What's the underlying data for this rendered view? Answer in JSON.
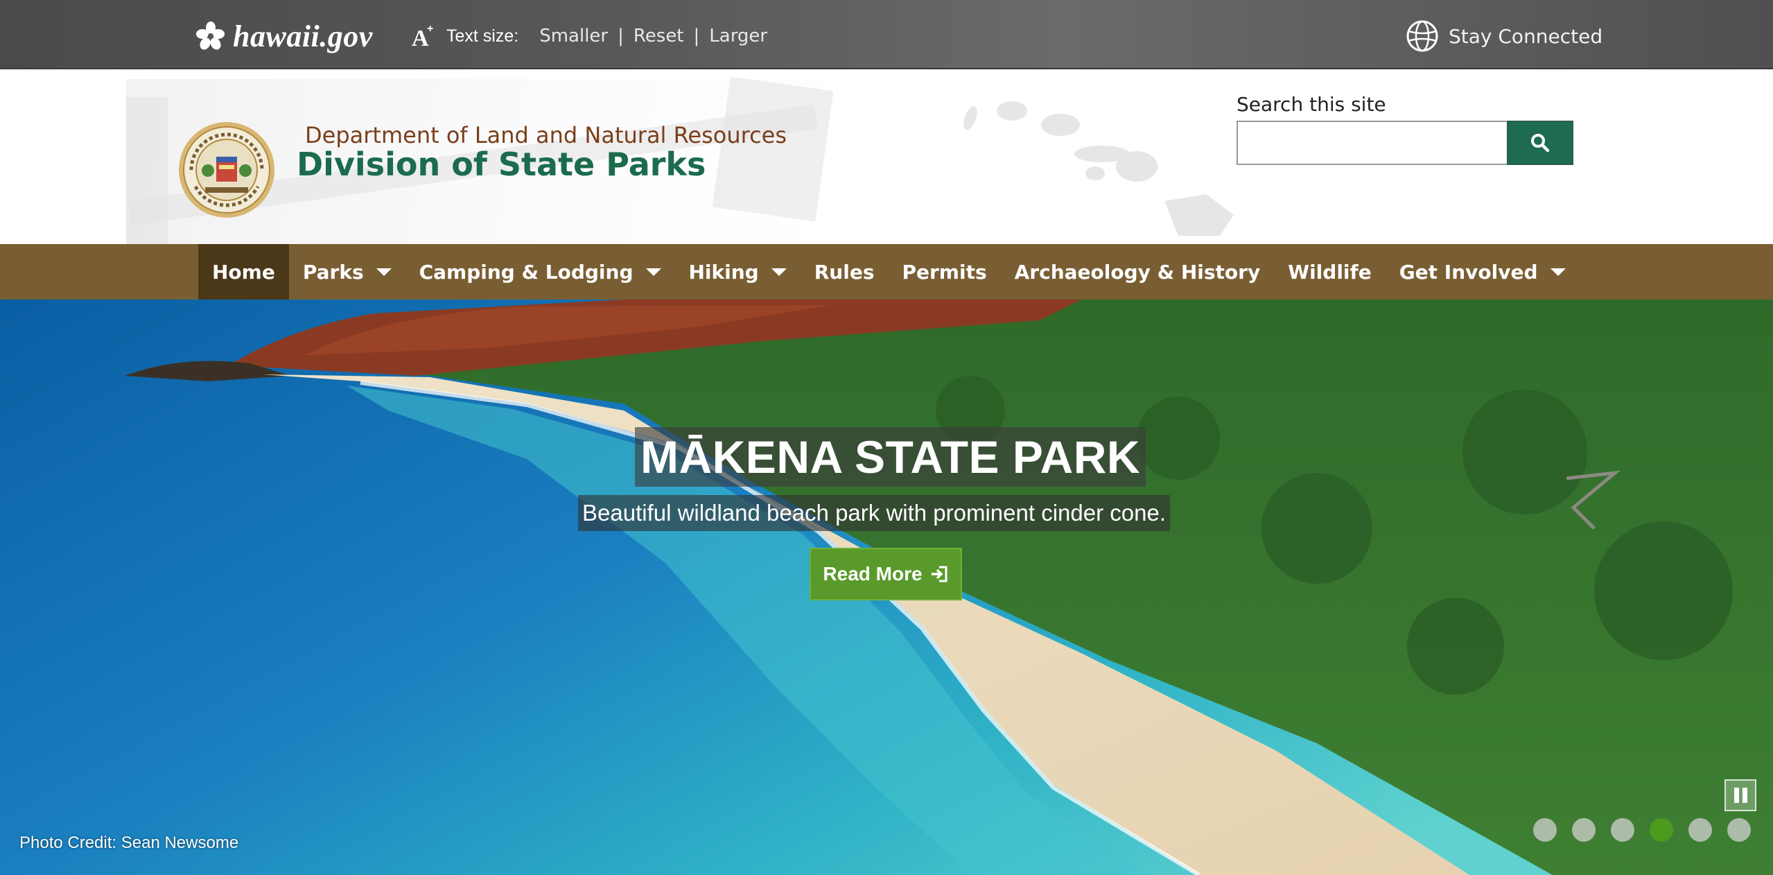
{
  "topbar": {
    "gov_logo_text": "hawaii.gov",
    "text_size_label": "Text size:",
    "text_size_options": [
      "Smaller",
      "Reset",
      "Larger"
    ],
    "separator": "|",
    "stay_connected": "Stay Connected"
  },
  "header": {
    "department": "Department of Land and Natural Resources",
    "division": "Division of State Parks",
    "search_label": "Search this site",
    "search_value": ""
  },
  "nav": {
    "items": [
      {
        "label": "Home",
        "active": true,
        "dropdown": false
      },
      {
        "label": "Parks",
        "active": false,
        "dropdown": true
      },
      {
        "label": "Camping & Lodging",
        "active": false,
        "dropdown": true
      },
      {
        "label": "Hiking",
        "active": false,
        "dropdown": true
      },
      {
        "label": "Rules",
        "active": false,
        "dropdown": false
      },
      {
        "label": "Permits",
        "active": false,
        "dropdown": false
      },
      {
        "label": "Archaeology & History",
        "active": false,
        "dropdown": false
      },
      {
        "label": "Wildlife",
        "active": false,
        "dropdown": false
      },
      {
        "label": "Get Involved",
        "active": false,
        "dropdown": true
      }
    ]
  },
  "hero": {
    "title": "MĀKENA STATE PARK",
    "subtitle": "Beautiful wildland beach park with prominent cinder cone.",
    "read_more": "Read More",
    "photo_credit": "Photo Credit: Sean Newsome",
    "slide_count": 6,
    "active_slide": 4
  },
  "colors": {
    "topbar": "#555555",
    "nav": "#7a5e33",
    "nav_active": "#4a3818",
    "division_green": "#1b6b4d",
    "department_brown": "#7a3e1a",
    "search_button": "#1c6b52",
    "read_more_green": "#5a9a2c",
    "active_dot": "#4c9a1e"
  },
  "icons": {
    "gov_logo": "hibiscus-icon",
    "text_size": "text-size-icon",
    "stay_connected": "globe-icon",
    "search": "search-icon",
    "read_more": "sign-in-icon",
    "pause": "pause-icon",
    "seal": "state-seal"
  }
}
